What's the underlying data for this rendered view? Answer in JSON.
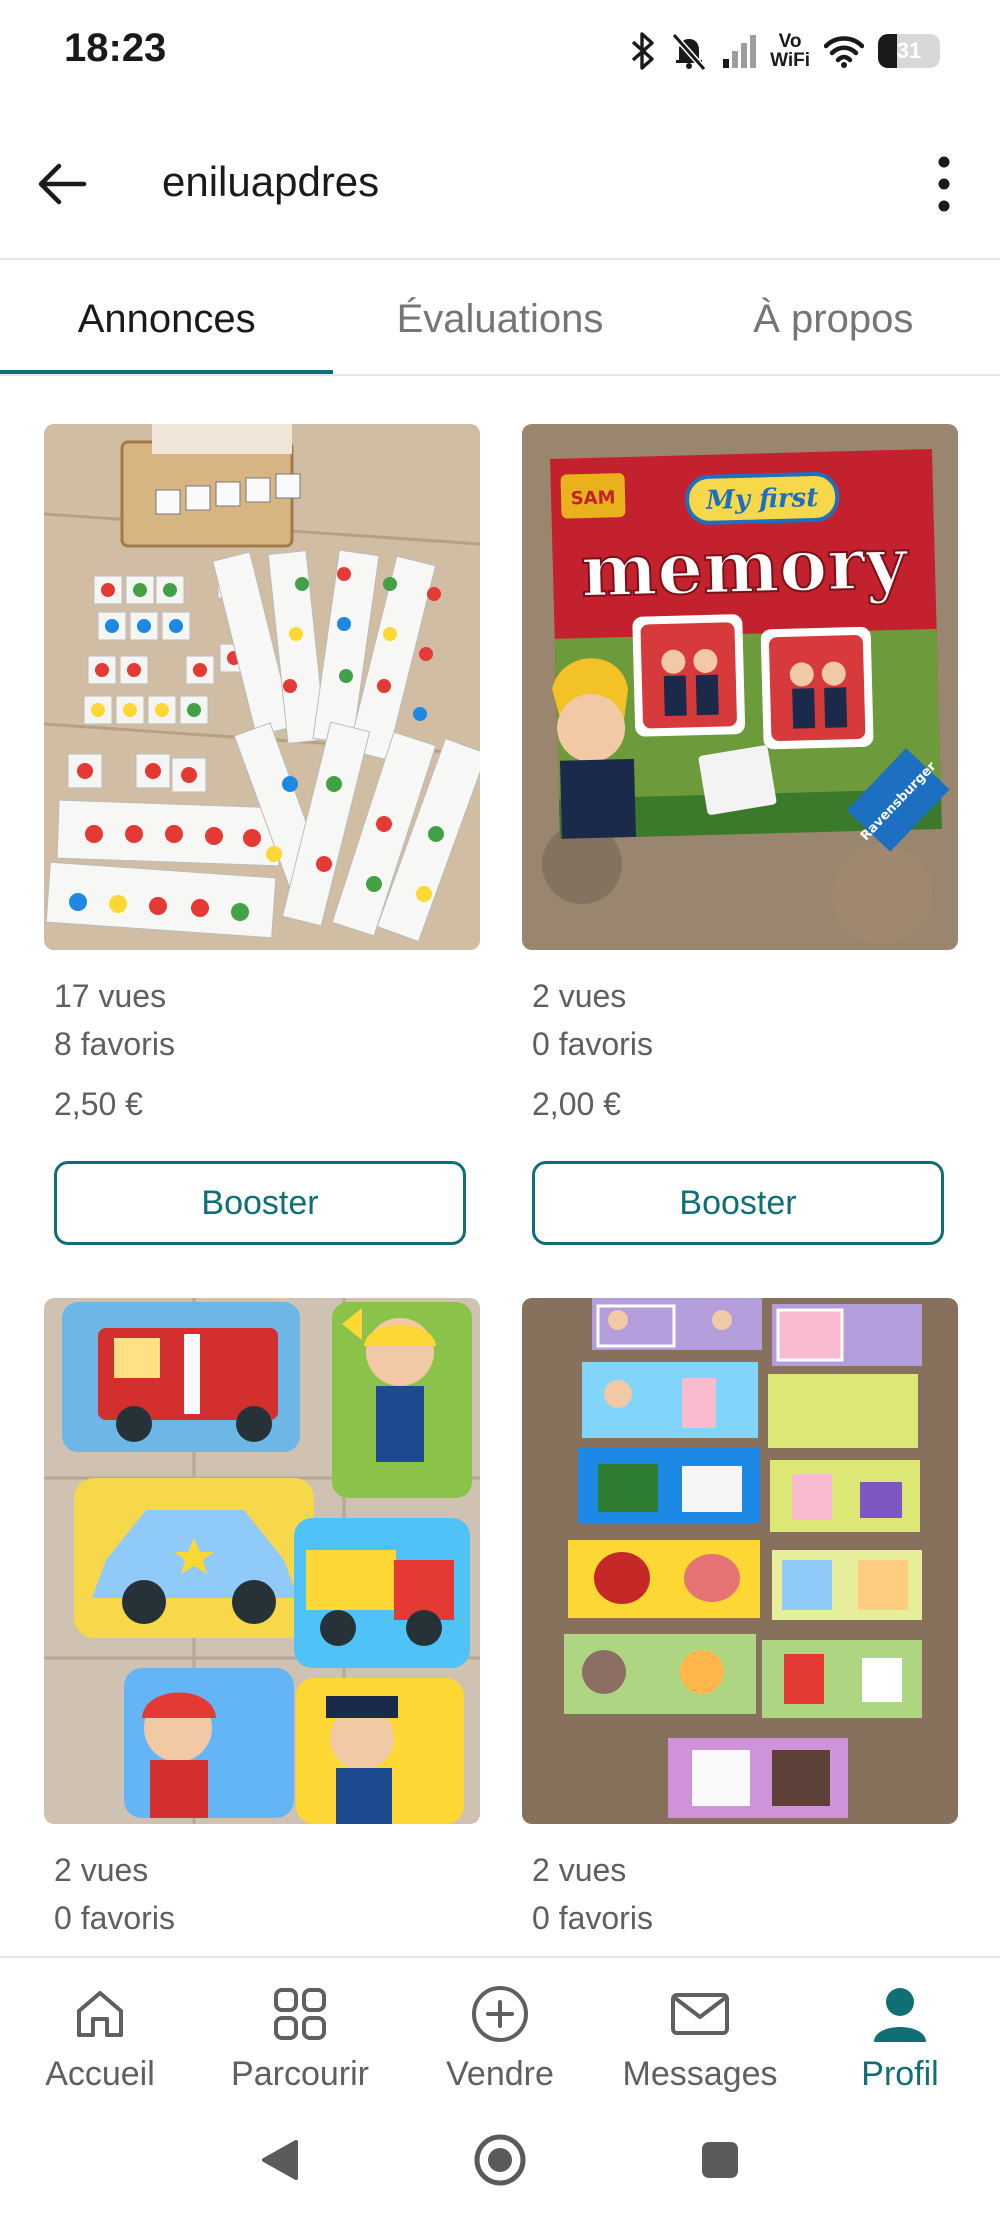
{
  "status_bar": {
    "time": "18:23",
    "vowifi_top": "Vo",
    "vowifi_bottom": "WiFi",
    "battery_level": "31",
    "battery_fraction": 0.31
  },
  "app_bar": {
    "username": "eniluapdres",
    "back_icon": "arrow-left-icon",
    "more_icon": "more-vert-icon"
  },
  "tabs": [
    {
      "label": "Annonces",
      "active": true
    },
    {
      "label": "Évaluations",
      "active": false
    },
    {
      "label": "À propos",
      "active": false
    }
  ],
  "listings": [
    {
      "views": "17 vues",
      "favorites": "8 favoris",
      "price": "2,50 €",
      "button": "Booster"
    },
    {
      "views": "2 vues",
      "favorites": "0 favoris",
      "price": "2,00 €",
      "button": "Booster"
    },
    {
      "views": "2 vues",
      "favorites": "0 favoris"
    },
    {
      "views": "2 vues",
      "favorites": "0 favoris"
    }
  ],
  "memory_box": {
    "brand": "SAM",
    "line1": "My first",
    "line2": "memory",
    "publisher": "Ravensburger"
  },
  "bottom_nav": [
    {
      "label": "Accueil",
      "icon": "home-icon"
    },
    {
      "label": "Parcourir",
      "icon": "grid-icon"
    },
    {
      "label": "Vendre",
      "icon": "plus-circle-icon"
    },
    {
      "label": "Messages",
      "icon": "mail-icon"
    },
    {
      "label": "Profil",
      "icon": "person-icon",
      "active": true
    }
  ],
  "colors": {
    "accent": "#0f6f74",
    "text_muted": "#5f5f5f"
  }
}
